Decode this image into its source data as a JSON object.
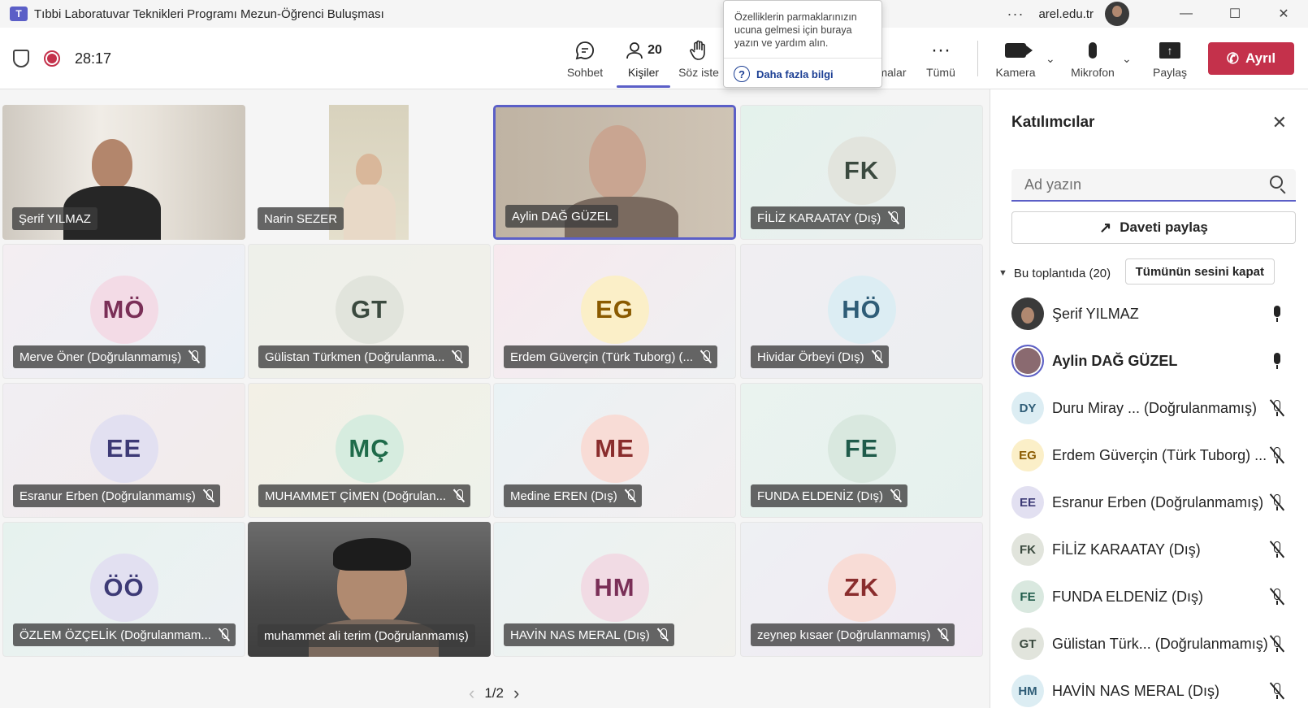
{
  "window": {
    "title": "Tıbbi Laboratuvar Teknikleri Programı Mezun-Öğrenci Buluşması",
    "org": "arel.edu.tr",
    "more": "···"
  },
  "toolbar": {
    "timer": "28:17",
    "chat_label": "Sohbet",
    "people_label": "Kişiler",
    "people_count": "20",
    "raise_label": "Söz iste",
    "reactions_label": "malar",
    "more_label": "Tümü",
    "camera_label": "Kamera",
    "mic_label": "Mikrofon",
    "share_label": "Paylaş",
    "leave_label": "Ayrıl"
  },
  "tooltip": {
    "text": "Özelliklerin parmaklarınızın ucuna gelmesi için buraya yazın ve yardım alın.",
    "link": "Daha fazla bilgi"
  },
  "tiles": [
    {
      "name": "Şerif YILMAZ",
      "type": "video",
      "muted": false
    },
    {
      "name": "Narin SEZER",
      "type": "video",
      "muted": false
    },
    {
      "name": "Aylin DAĞ GÜZEL",
      "type": "video",
      "muted": false,
      "speaking": true
    },
    {
      "name": "FİLİZ KARAATAY (Dış)",
      "initials": "FK",
      "muted": true,
      "color": "#3b4a3f",
      "bg": "#e4e8e0"
    },
    {
      "name": "Merve Öner (Doğrulanmamış)",
      "initials": "MÖ",
      "muted": true,
      "color": "#7a2f57",
      "bg": "#f3dbe6"
    },
    {
      "name": "Gülistan Türkmen (Doğrulanma...",
      "initials": "GT",
      "muted": true,
      "color": "#3b4a3f",
      "bg": "#e1e4dc"
    },
    {
      "name": "Erdem Güverçin (Türk Tuborg) (...",
      "initials": "EG",
      "muted": true,
      "color": "#8a5a00",
      "bg": "#fbefc8"
    },
    {
      "name": "Hividar Örbeyi (Dış)",
      "initials": "HÖ",
      "muted": true,
      "color": "#2f5d77",
      "bg": "#dcedf3"
    },
    {
      "name": "Esranur Erben (Doğrulanmamış)",
      "initials": "EE",
      "muted": true,
      "color": "#3d3a76",
      "bg": "#e2e0f1"
    },
    {
      "name": "MUHAMMET ÇİMEN (Doğrulan...",
      "initials": "MÇ",
      "muted": true,
      "color": "#1f6b4a",
      "bg": "#d6ecdf"
    },
    {
      "name": "Medine EREN (Dış)",
      "initials": "ME",
      "muted": true,
      "color": "#8a2d2d",
      "bg": "#f8dcd6"
    },
    {
      "name": "FUNDA ELDENİZ (Dış)",
      "initials": "FE",
      "muted": true,
      "color": "#1f5b4a",
      "bg": "#d9e8df"
    },
    {
      "name": "ÖZLEM ÖZÇELİK (Doğrulanmam...",
      "initials": "ÖÖ",
      "muted": true,
      "color": "#3d3a76",
      "bg": "#e2e0f1"
    },
    {
      "name": "muhammet ali terim (Doğrulanmamış)",
      "type": "video",
      "muted": false
    },
    {
      "name": "HAVİN NAS MERAL (Dış)",
      "initials": "HM",
      "muted": true,
      "color": "#7a2f57",
      "bg": "#f1dbe4"
    },
    {
      "name": "zeynep kısaer (Doğrulanmamış)",
      "initials": "ZK",
      "muted": true,
      "color": "#8a2d2d",
      "bg": "#f8dcd6"
    }
  ],
  "pager": {
    "label": "1/2",
    "prev": "‹",
    "next": "›"
  },
  "panel": {
    "title": "Katılımcılar",
    "search_placeholder": "Ad yazın",
    "invite_label": "Daveti paylaş",
    "section_label": "Bu toplantıda (20)",
    "mute_all_label": "Tümünün sesini kapat",
    "participants": [
      {
        "initials": "",
        "name": "Şerif YILMAZ",
        "muted": false,
        "photo": true,
        "bold": false
      },
      {
        "initials": "",
        "name": "Aylin DAĞ GÜZEL",
        "muted": false,
        "photo": true,
        "bold": true
      },
      {
        "initials": "DY",
        "name": "Duru Miray ...  (Doğrulanmamış)",
        "muted": true,
        "color": "#2f5d77",
        "bg": "#dcedf3"
      },
      {
        "initials": "EG",
        "name": "Erdem Güverçin (Türk Tuborg) ...",
        "muted": true,
        "color": "#8a5a00",
        "bg": "#fbefc8"
      },
      {
        "initials": "EE",
        "name": "Esranur Erben (Doğrulanmamış)",
        "muted": true,
        "color": "#3d3a76",
        "bg": "#e2e0f1"
      },
      {
        "initials": "FK",
        "name": "FİLİZ KARAATAY (Dış)",
        "muted": true,
        "color": "#3b4a3f",
        "bg": "#e1e4dc"
      },
      {
        "initials": "FE",
        "name": "FUNDA ELDENİZ (Dış)",
        "muted": true,
        "color": "#1f5b4a",
        "bg": "#d9e8df"
      },
      {
        "initials": "GT",
        "name": "Gülistan Türk... (Doğrulanmamış)",
        "muted": true,
        "color": "#3b4a3f",
        "bg": "#e1e4dc"
      },
      {
        "initials": "HM",
        "name": "HAVİN NAS MERAL (Dış)",
        "muted": true,
        "color": "#2f5d77",
        "bg": "#dcedf3"
      }
    ]
  },
  "colors": {
    "accent": "#5b5fc7",
    "leave": "#c4314b"
  }
}
